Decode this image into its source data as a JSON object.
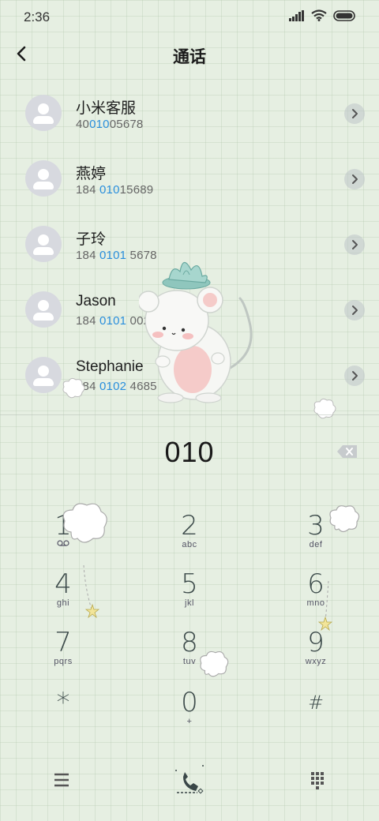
{
  "status_bar": {
    "time": "2:36"
  },
  "header": {
    "title": "通话"
  },
  "contacts": [
    {
      "name": "小米客服",
      "number_pre": "40",
      "number_hl": "010",
      "number_post": "05678"
    },
    {
      "name": "燕婷",
      "number_pre": "184 ",
      "number_hl": "010",
      "number_post": "15689"
    },
    {
      "name": "子玲",
      "number_pre": "184 ",
      "number_hl": "0101",
      "number_post": " 5678"
    },
    {
      "name": "Jason",
      "number_pre": "184 ",
      "number_hl": "0101",
      "number_post": " 0029"
    },
    {
      "name": "Stephanie",
      "number_pre": "184 ",
      "number_hl": "0102",
      "number_post": " 4685"
    }
  ],
  "dial": {
    "input": "010"
  },
  "keypad": [
    {
      "digit": "1",
      "letters": ""
    },
    {
      "digit": "2",
      "letters": "abc"
    },
    {
      "digit": "3",
      "letters": "def"
    },
    {
      "digit": "4",
      "letters": "ghi"
    },
    {
      "digit": "5",
      "letters": "jkl"
    },
    {
      "digit": "6",
      "letters": "mno"
    },
    {
      "digit": "7",
      "letters": "pqrs"
    },
    {
      "digit": "8",
      "letters": "tuv"
    },
    {
      "digit": "9",
      "letters": "wxyz"
    },
    {
      "digit": "*",
      "letters": ""
    },
    {
      "digit": "0",
      "letters": "+"
    },
    {
      "digit": "#",
      "letters": ""
    }
  ],
  "colors": {
    "highlight": "#2b8fdc",
    "background": "#e6efe2"
  },
  "icons": {
    "back": "back-arrow-icon",
    "detail": "chevron-right-icon",
    "backspace": "backspace-icon",
    "menu": "menu-icon",
    "call": "phone-icon",
    "dialpad": "dialpad-icon"
  }
}
